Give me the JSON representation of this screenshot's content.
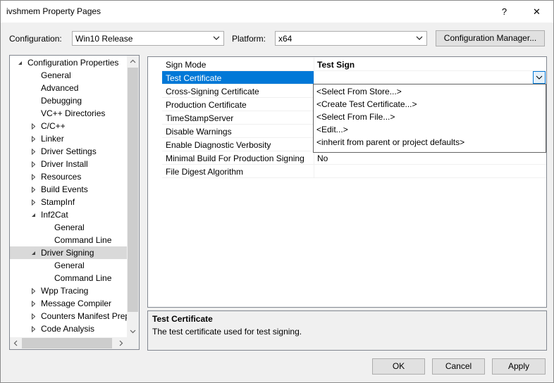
{
  "window": {
    "title": "ivshmem Property Pages",
    "help_label": "?",
    "close_label": "✕"
  },
  "config_bar": {
    "configuration_label": "Configuration:",
    "configuration_value": "Win10 Release",
    "platform_label": "Platform:",
    "platform_value": "x64",
    "config_manager_label": "Configuration Manager..."
  },
  "tree": {
    "items": [
      {
        "label": "Configuration Properties",
        "level": 0,
        "expander": "expanded"
      },
      {
        "label": "General",
        "level": 1,
        "expander": "none"
      },
      {
        "label": "Advanced",
        "level": 1,
        "expander": "none"
      },
      {
        "label": "Debugging",
        "level": 1,
        "expander": "none"
      },
      {
        "label": "VC++ Directories",
        "level": 1,
        "expander": "none"
      },
      {
        "label": "C/C++",
        "level": 1,
        "expander": "collapsed"
      },
      {
        "label": "Linker",
        "level": 1,
        "expander": "collapsed"
      },
      {
        "label": "Driver Settings",
        "level": 1,
        "expander": "collapsed"
      },
      {
        "label": "Driver Install",
        "level": 1,
        "expander": "collapsed"
      },
      {
        "label": "Resources",
        "level": 1,
        "expander": "collapsed"
      },
      {
        "label": "Build Events",
        "level": 1,
        "expander": "collapsed"
      },
      {
        "label": "StampInf",
        "level": 1,
        "expander": "collapsed"
      },
      {
        "label": "Inf2Cat",
        "level": 1,
        "expander": "expanded"
      },
      {
        "label": "General",
        "level": 2,
        "expander": "none"
      },
      {
        "label": "Command Line",
        "level": 2,
        "expander": "none"
      },
      {
        "label": "Driver Signing",
        "level": 1,
        "expander": "expanded",
        "selected": true
      },
      {
        "label": "General",
        "level": 2,
        "expander": "none"
      },
      {
        "label": "Command Line",
        "level": 2,
        "expander": "none"
      },
      {
        "label": "Wpp Tracing",
        "level": 1,
        "expander": "collapsed"
      },
      {
        "label": "Message Compiler",
        "level": 1,
        "expander": "collapsed"
      },
      {
        "label": "Counters Manifest Prep",
        "level": 1,
        "expander": "collapsed"
      },
      {
        "label": "Code Analysis",
        "level": 1,
        "expander": "collapsed"
      }
    ]
  },
  "properties": {
    "rows": [
      {
        "name": "Sign Mode",
        "value": "Test Sign",
        "bold": true
      },
      {
        "name": "Test Certificate",
        "value": "",
        "selected": true
      },
      {
        "name": "Cross-Signing Certificate",
        "value": ""
      },
      {
        "name": "Production Certificate",
        "value": ""
      },
      {
        "name": "TimeStampServer",
        "value": ""
      },
      {
        "name": "Disable Warnings",
        "value": ""
      },
      {
        "name": "Enable Diagnostic Verbosity",
        "value": ""
      },
      {
        "name": "Minimal Build For Production Signing",
        "value": "No"
      },
      {
        "name": "File Digest Algorithm",
        "value": ""
      }
    ],
    "dropdown_options": [
      "<Select From Store...>",
      "<Create Test Certificate...>",
      "<Select From File...>",
      "<Edit...>",
      "<inherit from parent or project defaults>"
    ]
  },
  "description": {
    "title": "Test Certificate",
    "text": "The test certificate used for test signing."
  },
  "buttons": {
    "ok": "OK",
    "cancel": "Cancel",
    "apply": "Apply"
  },
  "colors": {
    "selection": "#0078d7",
    "tree_selection": "#d9d9d9"
  }
}
